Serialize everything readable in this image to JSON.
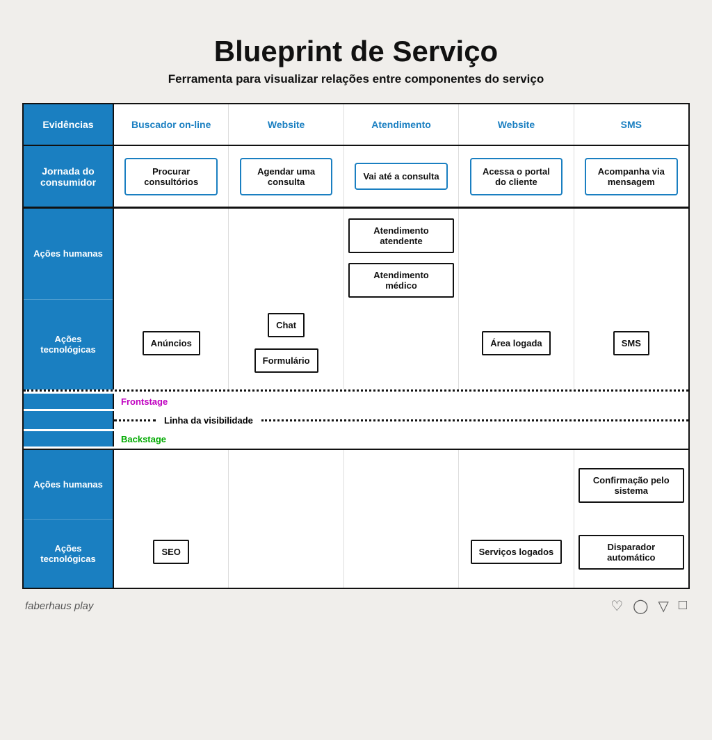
{
  "page": {
    "title": "Blueprint de Serviço",
    "subtitle": "Ferramenta para visualizar relações entre componentes do serviço"
  },
  "colors": {
    "blue": "#1a7fc1",
    "dark": "#111111",
    "white": "#ffffff",
    "bg": "#f0eeeb",
    "frontstage": "#c000c0",
    "backstage": "#00aa00"
  },
  "labels": {
    "evidencias": "Evidências",
    "jornada": "Jornada do consumidor",
    "acoes_humanas": "Ações humanas",
    "acoes_tecnologicas": "Ações tecnológicas",
    "frontstage": "Frontstage",
    "backstage": "Backstage",
    "visibility_line": "Linha da visibilidade"
  },
  "evidencias": {
    "col1": "Buscador on-line",
    "col2": "Website",
    "col3": "Atendimento",
    "col4": "Website",
    "col5": "SMS"
  },
  "jornada": {
    "col1": "Procurar consultórios",
    "col2": "Agendar uma consulta",
    "col3": "Vai até a consulta",
    "col4": "Acessa o portal do cliente",
    "col5": "Acompanha via mensagem"
  },
  "frontstage": {
    "acoes_humanas": {
      "col1": "",
      "col2": "",
      "col3_top": "Atendimento atendente",
      "col3_bot": "Atendimento médico",
      "col4": "",
      "col5": ""
    },
    "acoes_tecnologicas": {
      "col1": "Anúncios",
      "col2_top": "Chat",
      "col2_bot": "Formulário",
      "col3": "",
      "col4": "Área logada",
      "col5": "SMS"
    }
  },
  "backstage": {
    "acoes_humanas": {
      "col1": "",
      "col2": "",
      "col3": "",
      "col4": "",
      "col5": "Confirmação pelo sistema"
    },
    "acoes_tecnologicas": {
      "col1": "SEO",
      "col2": "",
      "col3": "",
      "col4": "Serviços logados",
      "col5": "Disparador automático"
    }
  },
  "footer": {
    "brand": "faberhaus play",
    "icons": [
      "♡",
      "○",
      "▽",
      "□"
    ]
  }
}
